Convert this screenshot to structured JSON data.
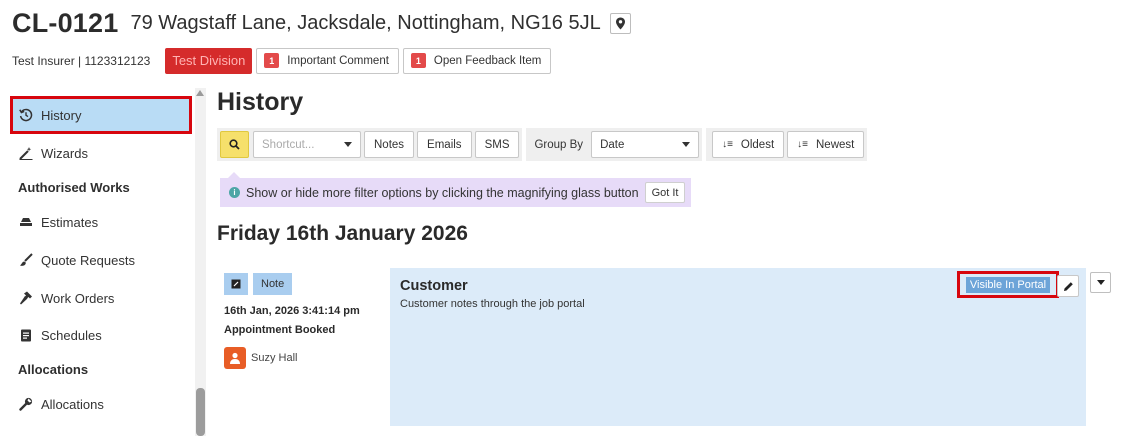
{
  "header": {
    "job_ref": "CL-0121",
    "address": "79 Wagstaff Lane, Jacksdale, Nottingham, NG16 5JL",
    "location_icon": "map-pin-icon"
  },
  "subheader": {
    "insurer": "Test Insurer | 1123312123",
    "division": "Test Division",
    "chips": [
      {
        "count": "1",
        "label": "Important Comment"
      },
      {
        "count": "1",
        "label": "Open Feedback Item"
      }
    ]
  },
  "sidebar": {
    "items": [
      {
        "label": "History",
        "icon": "history-icon",
        "active": true
      },
      {
        "label": "Wizards",
        "icon": "wand-icon"
      },
      {
        "heading": "Authorised Works"
      },
      {
        "label": "Estimates",
        "icon": "stack-icon"
      },
      {
        "label": "Quote Requests",
        "icon": "brush-icon"
      },
      {
        "label": "Work Orders",
        "icon": "hammer-icon"
      },
      {
        "label": "Schedules",
        "icon": "document-icon"
      },
      {
        "heading": "Allocations"
      },
      {
        "label": "Allocations",
        "icon": "wrench-icon"
      }
    ]
  },
  "main": {
    "title": "History",
    "toolbar": {
      "search_icon": "search-icon",
      "shortcut_placeholder": "Shortcut...",
      "filters": [
        "Notes",
        "Emails",
        "SMS"
      ],
      "group_by_label": "Group By",
      "group_by_value": "Date",
      "sort_oldest": "Oldest",
      "sort_newest": "Newest"
    },
    "hint": {
      "text": "Show or hide more filter options by clicking the magnifying glass button",
      "button": "Got It"
    },
    "date_heading": "Friday 16th January 2026",
    "entry": {
      "type": "Note",
      "timestamp": "16th Jan, 2026 3:41:14 pm",
      "event": "Appointment Booked",
      "user": "Suzy Hall",
      "title": "Customer",
      "body": "Customer notes through the job portal",
      "portal_badge": "Visible In Portal"
    }
  },
  "colors": {
    "accent_red": "#d52b2b",
    "highlight_outline": "#d7060e",
    "active_nav": "#b9dcf5",
    "note_bg": "#dcebf9",
    "search_yellow": "#f6e06b",
    "hint_bg": "#e7dbf8"
  }
}
